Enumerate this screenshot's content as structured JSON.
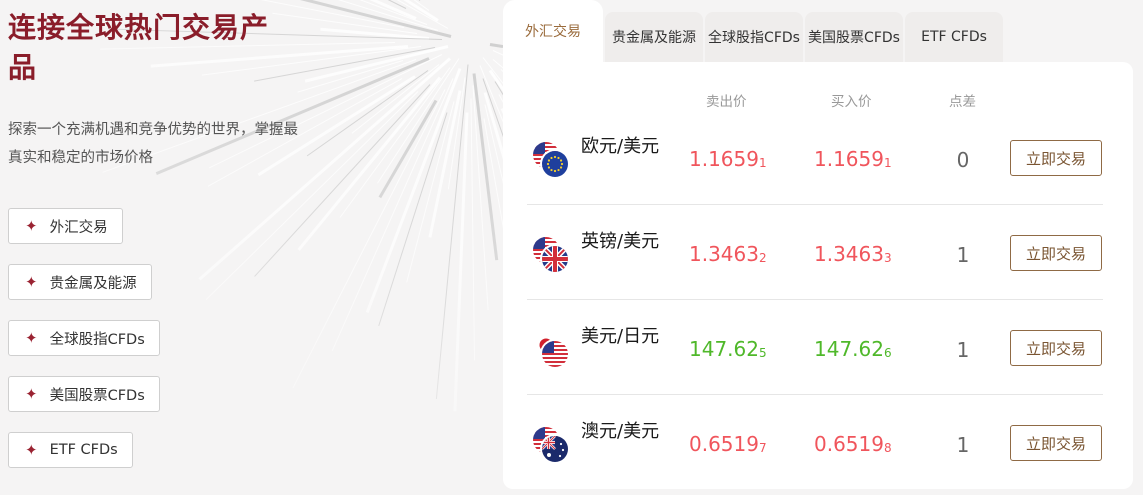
{
  "headline": "连接全球热门交易产品",
  "description": "探索一个充满机遇和竞争优势的世界，掌握最真实和稳定的市场价格",
  "categories": [
    {
      "label": "外汇交易",
      "icon": "sparkle-icon"
    },
    {
      "label": "贵金属及能源",
      "icon": "sparkle-icon"
    },
    {
      "label": "全球股指CFDs",
      "icon": "sparkle-icon"
    },
    {
      "label": "美国股票CFDs",
      "icon": "sparkle-icon"
    },
    {
      "label": "ETF CFDs",
      "icon": "sparkle-icon"
    }
  ],
  "tabs": [
    {
      "label": "外汇交易",
      "active": true
    },
    {
      "label": "贵金属及能源",
      "active": false
    },
    {
      "label": "全球股指CFDs",
      "active": false
    },
    {
      "label": "美国股票CFDs",
      "active": false
    },
    {
      "label": "ETF CFDs",
      "active": false
    }
  ],
  "table": {
    "headers": {
      "sell": "卖出价",
      "buy": "买入价",
      "spread": "点差"
    },
    "rows": [
      {
        "pair": "欧元/美元",
        "flags": [
          "us-flag",
          "eu-flag"
        ],
        "sell_main": "1.1659",
        "sell_sub": "1",
        "buy_main": "1.1659",
        "buy_sub": "1",
        "spread": "0",
        "trend": "up",
        "action": "立即交易"
      },
      {
        "pair": "英镑/美元",
        "flags": [
          "us-flag",
          "uk-flag"
        ],
        "sell_main": "1.3463",
        "sell_sub": "2",
        "buy_main": "1.3463",
        "buy_sub": "3",
        "spread": "1",
        "trend": "up",
        "action": "立即交易"
      },
      {
        "pair": "美元/日元",
        "flags": [
          "jp-flag",
          "us-flag"
        ],
        "sell_main": "147.62",
        "sell_sub": "5",
        "buy_main": "147.62",
        "buy_sub": "6",
        "spread": "1",
        "trend": "down",
        "action": "立即交易"
      },
      {
        "pair": "澳元/美元",
        "flags": [
          "us-flag",
          "au-flag"
        ],
        "sell_main": "0.6519",
        "sell_sub": "7",
        "buy_main": "0.6519",
        "buy_sub": "8",
        "spread": "1",
        "trend": "up",
        "action": "立即交易"
      }
    ]
  },
  "colors": {
    "brand": "#8a1d2a",
    "tab_active": "#9a6b3c",
    "price_up": "#f0555c",
    "price_down": "#4fb82a",
    "button_border": "#8f6a45"
  }
}
